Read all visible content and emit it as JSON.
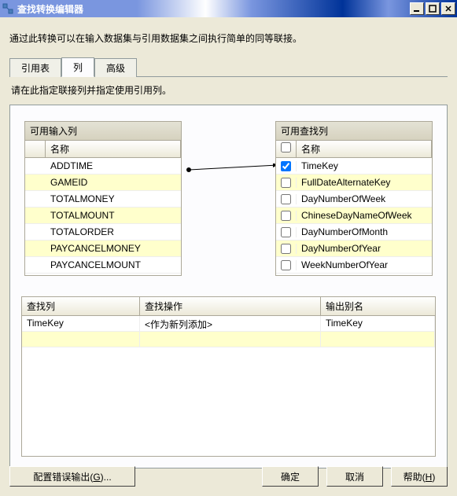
{
  "window": {
    "title": "查找转换编辑器"
  },
  "description": "通过此转换可以在输入数据集与引用数据集之间执行简单的同等联接。",
  "tabs": {
    "items": [
      {
        "label": "引用表",
        "active": false
      },
      {
        "label": "列",
        "active": true
      },
      {
        "label": "高级",
        "active": false
      }
    ],
    "instruction": "请在此指定联接列并指定使用引用列。"
  },
  "input_columns": {
    "title": "可用输入列",
    "name_header": "名称",
    "rows": [
      {
        "name": "ADDTIME",
        "striped": false
      },
      {
        "name": "GAMEID",
        "striped": true
      },
      {
        "name": "TOTALMONEY",
        "striped": false
      },
      {
        "name": "TOTALMOUNT",
        "striped": true
      },
      {
        "name": "TOTALORDER",
        "striped": false
      },
      {
        "name": "PAYCANCELMONEY",
        "striped": true
      },
      {
        "name": "PAYCANCELMOUNT",
        "striped": false
      }
    ]
  },
  "lookup_columns": {
    "title": "可用查找列",
    "name_header": "名称",
    "rows": [
      {
        "name": "TimeKey",
        "checked": true,
        "striped": false
      },
      {
        "name": "FullDateAlternateKey",
        "checked": false,
        "striped": true
      },
      {
        "name": "DayNumberOfWeek",
        "checked": false,
        "striped": false
      },
      {
        "name": "ChineseDayNameOfWeek",
        "checked": false,
        "striped": true
      },
      {
        "name": "DayNumberOfMonth",
        "checked": false,
        "striped": false
      },
      {
        "name": "DayNumberOfYear",
        "checked": false,
        "striped": true
      },
      {
        "name": "WeekNumberOfYear",
        "checked": false,
        "striped": false
      }
    ]
  },
  "mapping_table": {
    "headers": {
      "col1": "查找列",
      "col2": "查找操作",
      "col3": "输出别名"
    },
    "rows": [
      {
        "c1": "TimeKey",
        "c2": "<作为新列添加>",
        "c3": "TimeKey"
      },
      {
        "c1": "",
        "c2": "",
        "c3": "",
        "alt": true
      }
    ]
  },
  "buttons": {
    "configure_error": "配置错误输出(G)...",
    "configure_error_accel": "G",
    "ok": "确定",
    "cancel": "取消",
    "help": "帮助(H)",
    "help_accel": "H"
  }
}
